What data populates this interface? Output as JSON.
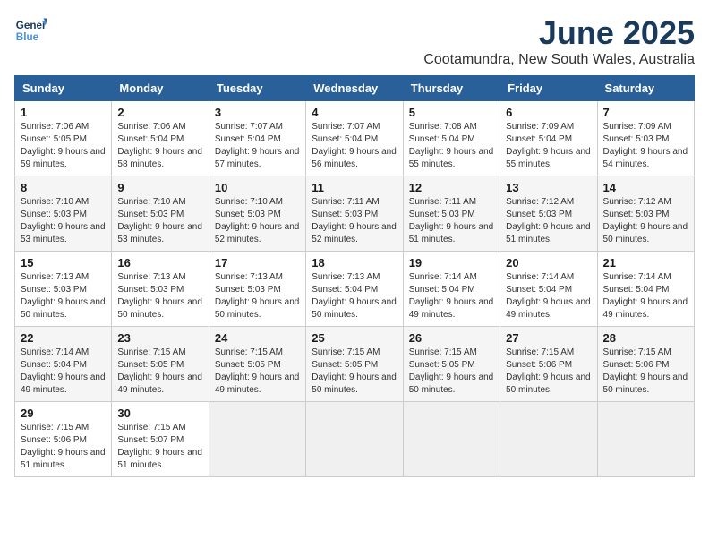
{
  "header": {
    "logo_line1": "General",
    "logo_line2": "Blue",
    "month": "June 2025",
    "location": "Cootamundra, New South Wales, Australia"
  },
  "weekdays": [
    "Sunday",
    "Monday",
    "Tuesday",
    "Wednesday",
    "Thursday",
    "Friday",
    "Saturday"
  ],
  "weeks": [
    [
      {
        "day": "1",
        "sunrise": "Sunrise: 7:06 AM",
        "sunset": "Sunset: 5:05 PM",
        "daylight": "Daylight: 9 hours and 59 minutes."
      },
      {
        "day": "2",
        "sunrise": "Sunrise: 7:06 AM",
        "sunset": "Sunset: 5:04 PM",
        "daylight": "Daylight: 9 hours and 58 minutes."
      },
      {
        "day": "3",
        "sunrise": "Sunrise: 7:07 AM",
        "sunset": "Sunset: 5:04 PM",
        "daylight": "Daylight: 9 hours and 57 minutes."
      },
      {
        "day": "4",
        "sunrise": "Sunrise: 7:07 AM",
        "sunset": "Sunset: 5:04 PM",
        "daylight": "Daylight: 9 hours and 56 minutes."
      },
      {
        "day": "5",
        "sunrise": "Sunrise: 7:08 AM",
        "sunset": "Sunset: 5:04 PM",
        "daylight": "Daylight: 9 hours and 55 minutes."
      },
      {
        "day": "6",
        "sunrise": "Sunrise: 7:09 AM",
        "sunset": "Sunset: 5:04 PM",
        "daylight": "Daylight: 9 hours and 55 minutes."
      },
      {
        "day": "7",
        "sunrise": "Sunrise: 7:09 AM",
        "sunset": "Sunset: 5:03 PM",
        "daylight": "Daylight: 9 hours and 54 minutes."
      }
    ],
    [
      {
        "day": "8",
        "sunrise": "Sunrise: 7:10 AM",
        "sunset": "Sunset: 5:03 PM",
        "daylight": "Daylight: 9 hours and 53 minutes."
      },
      {
        "day": "9",
        "sunrise": "Sunrise: 7:10 AM",
        "sunset": "Sunset: 5:03 PM",
        "daylight": "Daylight: 9 hours and 53 minutes."
      },
      {
        "day": "10",
        "sunrise": "Sunrise: 7:10 AM",
        "sunset": "Sunset: 5:03 PM",
        "daylight": "Daylight: 9 hours and 52 minutes."
      },
      {
        "day": "11",
        "sunrise": "Sunrise: 7:11 AM",
        "sunset": "Sunset: 5:03 PM",
        "daylight": "Daylight: 9 hours and 52 minutes."
      },
      {
        "day": "12",
        "sunrise": "Sunrise: 7:11 AM",
        "sunset": "Sunset: 5:03 PM",
        "daylight": "Daylight: 9 hours and 51 minutes."
      },
      {
        "day": "13",
        "sunrise": "Sunrise: 7:12 AM",
        "sunset": "Sunset: 5:03 PM",
        "daylight": "Daylight: 9 hours and 51 minutes."
      },
      {
        "day": "14",
        "sunrise": "Sunrise: 7:12 AM",
        "sunset": "Sunset: 5:03 PM",
        "daylight": "Daylight: 9 hours and 50 minutes."
      }
    ],
    [
      {
        "day": "15",
        "sunrise": "Sunrise: 7:13 AM",
        "sunset": "Sunset: 5:03 PM",
        "daylight": "Daylight: 9 hours and 50 minutes."
      },
      {
        "day": "16",
        "sunrise": "Sunrise: 7:13 AM",
        "sunset": "Sunset: 5:03 PM",
        "daylight": "Daylight: 9 hours and 50 minutes."
      },
      {
        "day": "17",
        "sunrise": "Sunrise: 7:13 AM",
        "sunset": "Sunset: 5:03 PM",
        "daylight": "Daylight: 9 hours and 50 minutes."
      },
      {
        "day": "18",
        "sunrise": "Sunrise: 7:13 AM",
        "sunset": "Sunset: 5:04 PM",
        "daylight": "Daylight: 9 hours and 50 minutes."
      },
      {
        "day": "19",
        "sunrise": "Sunrise: 7:14 AM",
        "sunset": "Sunset: 5:04 PM",
        "daylight": "Daylight: 9 hours and 49 minutes."
      },
      {
        "day": "20",
        "sunrise": "Sunrise: 7:14 AM",
        "sunset": "Sunset: 5:04 PM",
        "daylight": "Daylight: 9 hours and 49 minutes."
      },
      {
        "day": "21",
        "sunrise": "Sunrise: 7:14 AM",
        "sunset": "Sunset: 5:04 PM",
        "daylight": "Daylight: 9 hours and 49 minutes."
      }
    ],
    [
      {
        "day": "22",
        "sunrise": "Sunrise: 7:14 AM",
        "sunset": "Sunset: 5:04 PM",
        "daylight": "Daylight: 9 hours and 49 minutes."
      },
      {
        "day": "23",
        "sunrise": "Sunrise: 7:15 AM",
        "sunset": "Sunset: 5:05 PM",
        "daylight": "Daylight: 9 hours and 49 minutes."
      },
      {
        "day": "24",
        "sunrise": "Sunrise: 7:15 AM",
        "sunset": "Sunset: 5:05 PM",
        "daylight": "Daylight: 9 hours and 49 minutes."
      },
      {
        "day": "25",
        "sunrise": "Sunrise: 7:15 AM",
        "sunset": "Sunset: 5:05 PM",
        "daylight": "Daylight: 9 hours and 50 minutes."
      },
      {
        "day": "26",
        "sunrise": "Sunrise: 7:15 AM",
        "sunset": "Sunset: 5:05 PM",
        "daylight": "Daylight: 9 hours and 50 minutes."
      },
      {
        "day": "27",
        "sunrise": "Sunrise: 7:15 AM",
        "sunset": "Sunset: 5:06 PM",
        "daylight": "Daylight: 9 hours and 50 minutes."
      },
      {
        "day": "28",
        "sunrise": "Sunrise: 7:15 AM",
        "sunset": "Sunset: 5:06 PM",
        "daylight": "Daylight: 9 hours and 50 minutes."
      }
    ],
    [
      {
        "day": "29",
        "sunrise": "Sunrise: 7:15 AM",
        "sunset": "Sunset: 5:06 PM",
        "daylight": "Daylight: 9 hours and 51 minutes."
      },
      {
        "day": "30",
        "sunrise": "Sunrise: 7:15 AM",
        "sunset": "Sunset: 5:07 PM",
        "daylight": "Daylight: 9 hours and 51 minutes."
      },
      null,
      null,
      null,
      null,
      null
    ]
  ]
}
